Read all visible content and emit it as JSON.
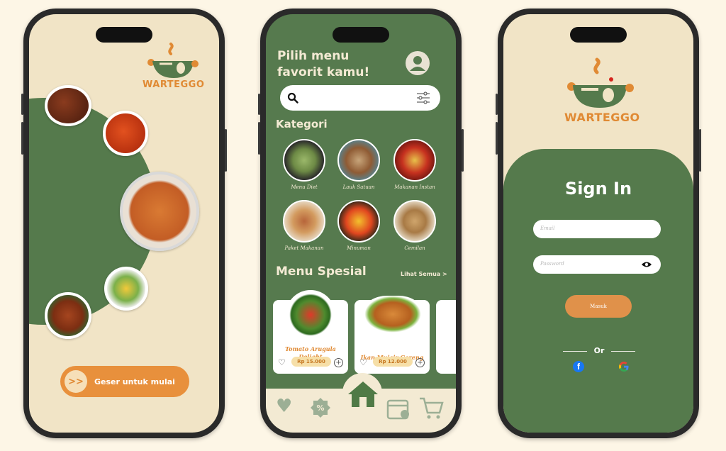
{
  "splash": {
    "logo_text": "WARTEGGO",
    "swipe_label": "Geser untuk mulai",
    "swipe_arrow": ">>"
  },
  "home": {
    "greeting": "Pilih menu favorit kamu!",
    "search_placeholder": "",
    "categories_title": "Kategori",
    "categories": [
      {
        "label": "Menu Diet"
      },
      {
        "label": "Lauk Satuan"
      },
      {
        "label": "Makanan Instan"
      },
      {
        "label": "Paket Makanan"
      },
      {
        "label": "Minuman"
      },
      {
        "label": "Cemilan"
      }
    ],
    "special_title": "Menu Spesial",
    "see_all": "Lihat Semua >",
    "specials": [
      {
        "name": "Tomato Arugula Delight",
        "price": "Rp 15.000"
      },
      {
        "name": "Ikan Mujair Goreng",
        "price": "Rp 12.000"
      }
    ],
    "nav": [
      "heart-icon",
      "discount-icon",
      "home-icon",
      "calendar-icon",
      "cart-icon"
    ]
  },
  "signin": {
    "logo_text": "WARTEGGO",
    "title": "Sign In",
    "email_placeholder": "Email",
    "password_placeholder": "Password",
    "submit_label": "Masuk",
    "or_label": "Or"
  },
  "colors": {
    "green": "#557a4c",
    "cream": "#f1e4c6",
    "orange": "#e8903c"
  }
}
